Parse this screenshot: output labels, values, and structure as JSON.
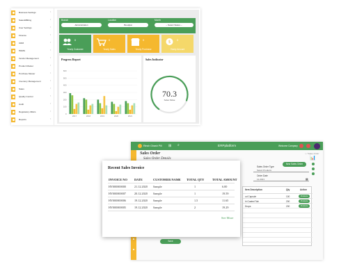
{
  "sidebar": {
    "items": [
      "Business Settings",
      "Sales&Billing",
      "User Settings",
      "Finance",
      "CRM",
      "HRMS",
      "Vendor Management",
      "Product Master",
      "Purchase Master",
      "Inventory Management",
      "Sales",
      "Quality Control",
      "Audit",
      "Regulatory Affairs",
      "Reports"
    ]
  },
  "filters": {
    "branch_label": "Branch",
    "branch_value": "Administration",
    "location_label": "Location",
    "location_value": "Boudpat",
    "month_label": "Month",
    "month_value": "-- Select Status --"
  },
  "cards": [
    {
      "label": "Yearly Customer",
      "value": "0",
      "icon": "users-icon",
      "color": "#4a9e58"
    },
    {
      "label": "Yearly Sales",
      "value": "0",
      "icon": "cart-icon",
      "color": "#f5b82e"
    },
    {
      "label": "Yearly Purchase",
      "value": "0",
      "icon": "store-icon",
      "color": "#f5b82e"
    },
    {
      "label": "Yearly Amount",
      "value": "0",
      "icon": "money-icon",
      "color": "#f5d86a"
    }
  ],
  "progress": {
    "title": "Progress Report"
  },
  "sales_indicator": {
    "title": "Sales Indicator",
    "value": "70.3",
    "label": "Sales Value",
    "percent": 70.3
  },
  "chart_data": {
    "type": "bar",
    "categories": [
      "2017",
      "2018",
      "2019",
      "2020",
      "2021"
    ],
    "series": [
      {
        "values": [
          290,
          220,
          200,
          170,
          180
        ]
      },
      {
        "values": [
          260,
          200,
          150,
          140,
          150
        ]
      },
      {
        "values": [
          70,
          60,
          80,
          40,
          60
        ]
      },
      {
        "values": [
          140,
          120,
          250,
          100,
          120
        ]
      },
      {
        "values": [
          160,
          140,
          120,
          130,
          150
        ]
      }
    ],
    "ylim": [
      0,
      600
    ],
    "y_ticks": [
      "0",
      "100",
      "200",
      "300",
      "400",
      "500",
      "600"
    ],
    "colors": [
      "#4a9e58",
      "#8dc63f",
      "#f5b82e",
      "#f6c445",
      "#a8dfb8"
    ]
  },
  "bottom": {
    "app_title": "ERPplatform",
    "brand": "Rinsh Ghash Pill",
    "user": "Welcome Company",
    "page_title": "Sales Order",
    "section_title": "Sales Order Details",
    "new_button": "New Sales Order",
    "order_type_label": "Sales Order Type",
    "order_type_value": "Select Products",
    "order_date_label": "Order Date",
    "order_date_value": "12-2021",
    "table_headers": [
      "Item Description",
      "Qty",
      "Action"
    ],
    "table_rows": [
      {
        "desc": "od Capsule",
        "qty": "100",
        "action": "Products"
      },
      {
        "desc": "hi Coated Tab",
        "qty": "200",
        "action": "Products"
      },
      {
        "desc": "Drops",
        "qty": "200",
        "action": "Products"
      }
    ],
    "save_button": "Save"
  },
  "popup": {
    "title": "Recent Sales Invoice",
    "headers": [
      "INVOICE NO",
      "DATE",
      "CUSTOMER NAME",
      "TOTAL QTY",
      "TOTAL AMOUNT"
    ],
    "rows": [
      {
        "invoice": "HY000000000",
        "date": "21.12.2020",
        "customer": "Sample",
        "qty": "1",
        "amount": "6.00"
      },
      {
        "invoice": "HY000000007",
        "date": "20.12.2020",
        "customer": "Sample",
        "qty": "1",
        "amount": "19.59"
      },
      {
        "invoice": "HY000000006",
        "date": "19.12.2020",
        "customer": "Sample",
        "qty": "1.5",
        "amount": "11.65"
      },
      {
        "invoice": "HY000000005",
        "date": "19.12.2020",
        "customer": "Sample",
        "qty": "2",
        "amount": "19.29"
      }
    ],
    "see_more": "See More"
  }
}
